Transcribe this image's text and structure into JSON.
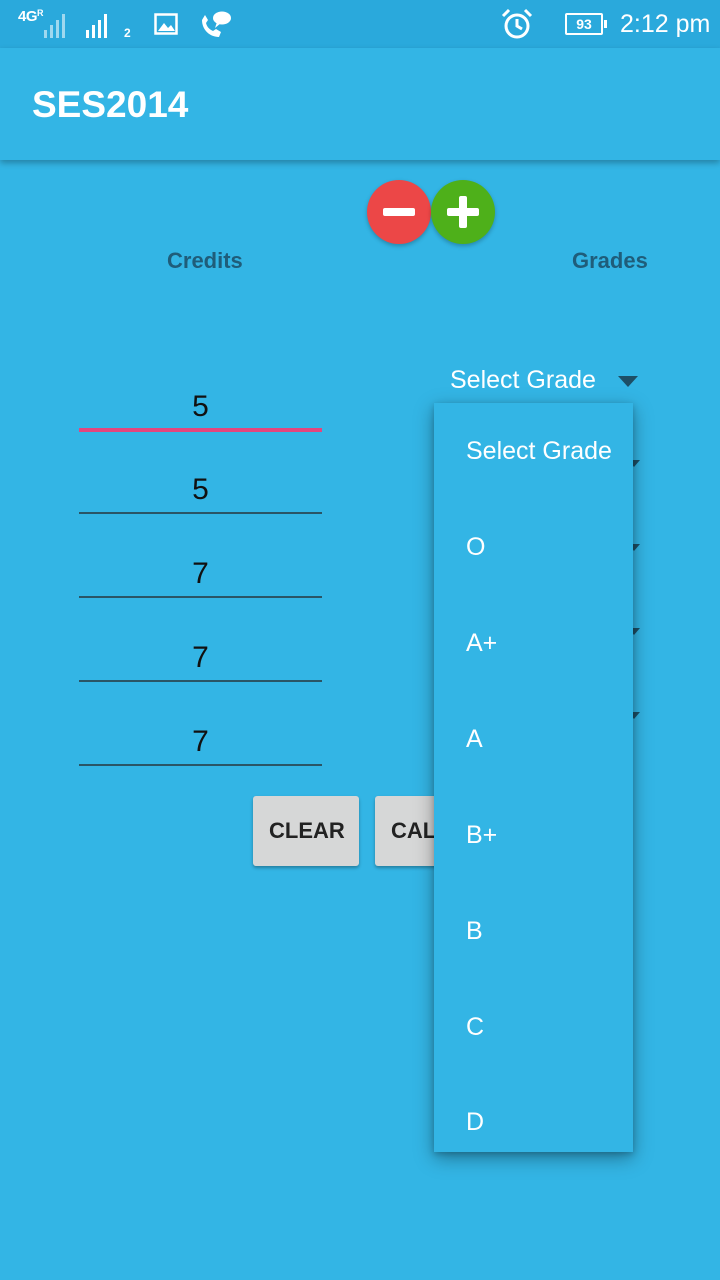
{
  "status_bar": {
    "network": "4G",
    "network_sub": "R",
    "sim_slot": "2",
    "battery": "93",
    "time": "2:12 pm",
    "icons": [
      "signal-icon",
      "image-icon",
      "call-chat-icon",
      "alarm-icon",
      "battery-icon"
    ]
  },
  "app_bar": {
    "title": "SES2014"
  },
  "controls": {
    "remove_icon": "minus-icon",
    "add_icon": "plus-icon"
  },
  "headers": {
    "credits": "Credits",
    "grades": "Grades"
  },
  "credits": [
    "5",
    "5",
    "7",
    "7",
    "7"
  ],
  "grade_select": {
    "selected": "Select Grade"
  },
  "dropdown": {
    "options": [
      "Select Grade",
      "O",
      "A+",
      "A",
      "B+",
      "B",
      "C",
      "D"
    ]
  },
  "buttons": {
    "clear": "CLEAR",
    "calculate": "CALCULATE"
  },
  "colors": {
    "background": "#33b5e5",
    "remove": "#ec4747",
    "add": "#4eb01a",
    "focus_underline": "#e4467e",
    "button": "#d6d7d7"
  }
}
